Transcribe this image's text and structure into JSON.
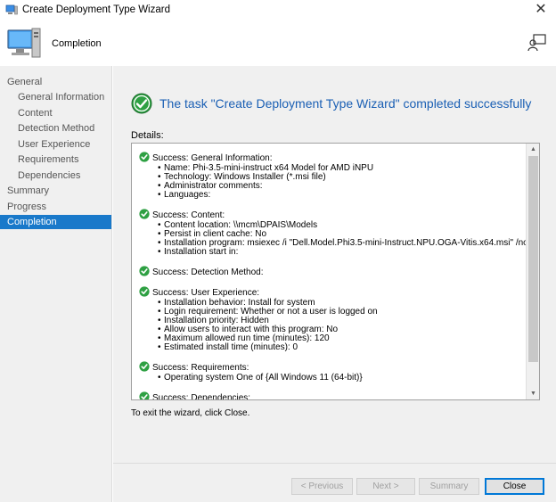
{
  "window": {
    "title": "Create Deployment Type Wizard"
  },
  "header": {
    "title": "Completion"
  },
  "sidebar": {
    "items": [
      {
        "label": "General",
        "level": 0,
        "active": false
      },
      {
        "label": "General Information",
        "level": 1,
        "active": false
      },
      {
        "label": "Content",
        "level": 1,
        "active": false
      },
      {
        "label": "Detection Method",
        "level": 1,
        "active": false
      },
      {
        "label": "User Experience",
        "level": 1,
        "active": false
      },
      {
        "label": "Requirements",
        "level": 1,
        "active": false
      },
      {
        "label": "Dependencies",
        "level": 1,
        "active": false
      },
      {
        "label": "Summary",
        "level": 0,
        "active": false
      },
      {
        "label": "Progress",
        "level": 0,
        "active": false
      },
      {
        "label": "Completion",
        "level": 0,
        "active": true
      }
    ]
  },
  "main": {
    "heading": "The task \"Create Deployment Type Wizard\" completed successfully",
    "details_label": "Details:",
    "exit_text": "To exit the wizard, click Close.",
    "sections": [
      {
        "title": "Success: General Information:",
        "items": [
          "Name: Phi-3.5-mini-instruct x64 Model for AMD iNPU",
          "Technology: Windows Installer (*.msi file)",
          "Administrator comments:",
          "Languages:"
        ]
      },
      {
        "title": "Success: Content:",
        "items": [
          "Content location: \\\\mcm\\DPAIS\\Models",
          "Persist in client cache: No",
          "Installation program: msiexec /i \"Dell.Model.Phi3.5-mini-Instruct.NPU.OGA-Vitis.x64.msi\" /norestart /qn",
          "Installation start in:"
        ]
      },
      {
        "title": "Success: Detection Method:",
        "items": []
      },
      {
        "title": "Success: User Experience:",
        "items": [
          "Installation behavior: Install for system",
          "Login requirement: Whether or not a user is logged on",
          "Installation priority: Hidden",
          "Allow users to interact with this program: No",
          "Maximum allowed run time (minutes): 120",
          "Estimated install time (minutes): 0"
        ]
      },
      {
        "title": "Success: Requirements:",
        "items": [
          "Operating system  One of  {All Windows 11 (64-bit)}"
        ]
      },
      {
        "title": "Success: Dependencies:",
        "items": []
      }
    ]
  },
  "footer": {
    "previous_label": "< Previous",
    "next_label": "Next >",
    "summary_label": "Summary",
    "close_label": "Close"
  },
  "colors": {
    "accent": "#1979ca",
    "heading": "#1a5fb4",
    "success": "#2ea043"
  }
}
